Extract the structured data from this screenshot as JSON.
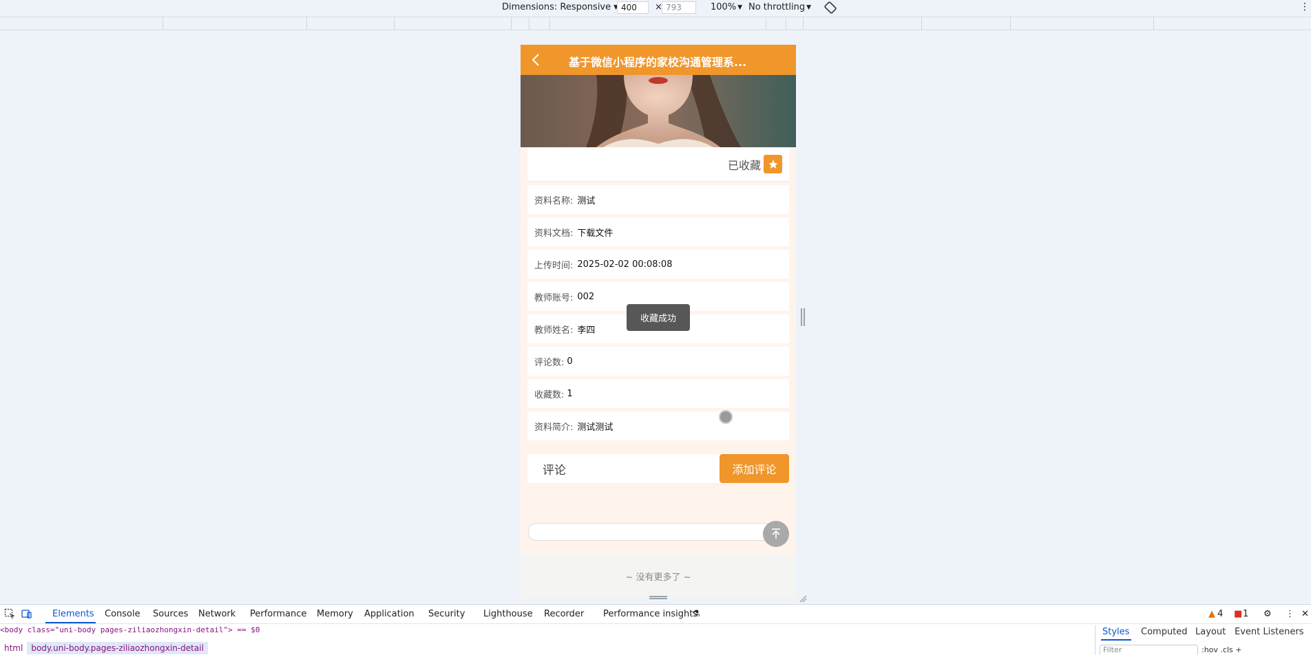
{
  "device_toolbar": {
    "dimensions_label": "Dimensions: Responsive",
    "width": "400",
    "height": "793",
    "times": "×",
    "zoom": "100%",
    "throttling": "No throttling",
    "more": "⋮"
  },
  "app": {
    "nav_title": "基于微信小程序的家校沟通管理系...",
    "collect_label": "已收藏",
    "fields": [
      {
        "label": "资料名称:",
        "value": "测试"
      },
      {
        "label": "资料文档:",
        "value": "下载文件"
      },
      {
        "label": "上传时间:",
        "value": "2025-02-02 00:08:08"
      },
      {
        "label": "教师账号:",
        "value": "002"
      },
      {
        "label": "教师姓名:",
        "value": "李四"
      },
      {
        "label": "评论数:",
        "value": "0"
      },
      {
        "label": "收藏数:",
        "value": "1"
      },
      {
        "label": "资料简介:",
        "value": "测试测试"
      }
    ],
    "comment_title": "评论",
    "add_comment_button": "添加评论",
    "no_more": "~ 没有更多了 ~",
    "toast": "收藏成功",
    "accent_color": "#f0962a"
  },
  "devtools": {
    "tabs": [
      "Elements",
      "Console",
      "Sources",
      "Network",
      "Performance",
      "Memory",
      "Application",
      "Security",
      "Lighthouse",
      "Recorder",
      "Performance insights"
    ],
    "warnings": "4",
    "errors": "1",
    "dom_line": "<body class=\"uni-body pages-ziliaozhongxin-detail\"> == $0",
    "breadcrumbs": [
      "html",
      "body.uni-body.pages-ziliaozhongxin-detail"
    ],
    "styles_tabs": [
      "Styles",
      "Computed",
      "Layout",
      "Event Listeners"
    ],
    "filter_placeholder": "Filter",
    "style_tools": ":hov .cls +"
  }
}
